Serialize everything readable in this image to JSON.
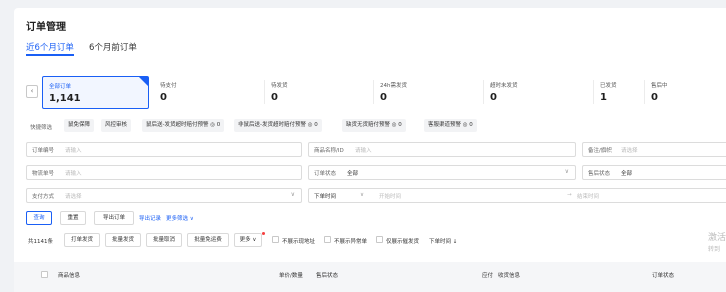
{
  "page": {
    "title": "订单管理"
  },
  "tabs": [
    {
      "label": "近6个月订单"
    },
    {
      "label": "6个月前订单"
    }
  ],
  "collapse_icon": "‹",
  "status_cards": [
    {
      "label": "全部订单",
      "value": "1,141",
      "selected": true
    },
    {
      "label": "待支付",
      "value": "0"
    },
    {
      "label": "待发货",
      "value": "0"
    },
    {
      "label": "24h需发货",
      "value": "0"
    },
    {
      "label": "超时未发货",
      "value": "0"
    },
    {
      "label": "已发货",
      "value": "1"
    },
    {
      "label": "售后中",
      "value": "0"
    }
  ],
  "quick_filter": {
    "label": "快捷筛选",
    "chips": [
      "鼠免保障",
      "风控审核",
      "鼠后送-发货超时赔付预警 ◎ 0",
      "非鼠后送-发货超时赔付预警 ◎ 0",
      "缺货无货赔付预警 ◎ 0",
      "客服渠道预警 ◎ 0"
    ]
  },
  "filters": {
    "order_no": {
      "label": "订单编号",
      "placeholder": "请输入"
    },
    "product": {
      "label": "商品名称/ID",
      "placeholder": "请输入"
    },
    "remark": {
      "label": "备注/旗帜",
      "placeholder": "请选择"
    },
    "logistics_no": {
      "label": "物流单号",
      "placeholder": "请输入"
    },
    "order_status": {
      "label": "订单状态",
      "value": "全部"
    },
    "after_sale_status": {
      "label": "售后状态",
      "value": "全部"
    },
    "payment": {
      "label": "支付方式",
      "placeholder": "请选择"
    },
    "time_type": {
      "value": "下单时间"
    },
    "start_time": {
      "placeholder": "开始时间"
    },
    "time_sep": "→",
    "end_time": {
      "placeholder": "结束时间"
    }
  },
  "actions": {
    "query": "查询",
    "reset": "重置",
    "export": "导出订单",
    "export_log": "导出记录",
    "more_filter": "更多筛选 ∨"
  },
  "toolbar": {
    "count": "共1141条",
    "print_ship": "打单发货",
    "batch_ship": "批量发货",
    "batch_cancel": "批量取消",
    "batch_free": "批量免运费",
    "more": "更多 ∨",
    "opt1": "不展示现地址",
    "opt2": "不展示异常单",
    "opt3": "仅展示催发货",
    "sort": "下单时间 ↓"
  },
  "side_hint": {
    "line1": "激活",
    "line2": "转到"
  },
  "table_header": {
    "product_info": "商品信息",
    "price_qty": "单价/数量",
    "after_sale": "售后状态",
    "paid": "应付",
    "receiver": "收货信息",
    "order_status": "订单状态"
  },
  "colors": {
    "accent": "#1a5ff5",
    "alert": "#f53f3f"
  }
}
